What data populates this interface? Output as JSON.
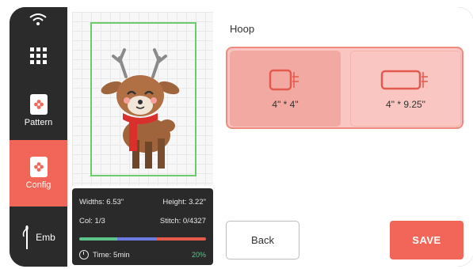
{
  "sidebar": {
    "items": [
      {
        "id": "grid",
        "icon": "grid-icon",
        "label": ""
      },
      {
        "id": "pattern",
        "icon": "pattern-icon",
        "label": "Pattern"
      },
      {
        "id": "config",
        "icon": "config-icon",
        "label": "Config"
      },
      {
        "id": "emb",
        "icon": "needle-icon",
        "label": "Emb"
      }
    ],
    "active": "config"
  },
  "info": {
    "widths": "Widths: 6.53\"",
    "height": "Height: 3.22\"",
    "col": "Col: 1/3",
    "stitch": "Stitch: 0/4327",
    "time": "Time: 5min",
    "percent": "20%",
    "progress": 0.2
  },
  "hoop": {
    "title": "Hoop",
    "options": [
      {
        "label": "4\" * 4\"",
        "selected": true
      },
      {
        "label": "4\" * 9.25\"",
        "selected": false
      }
    ]
  },
  "buttons": {
    "back": "Back",
    "save": "SAVE"
  },
  "colors": {
    "accent": "#f26659",
    "sidebar_bg": "#2b2b2b",
    "hoop_outline": "#6ccb6c"
  }
}
